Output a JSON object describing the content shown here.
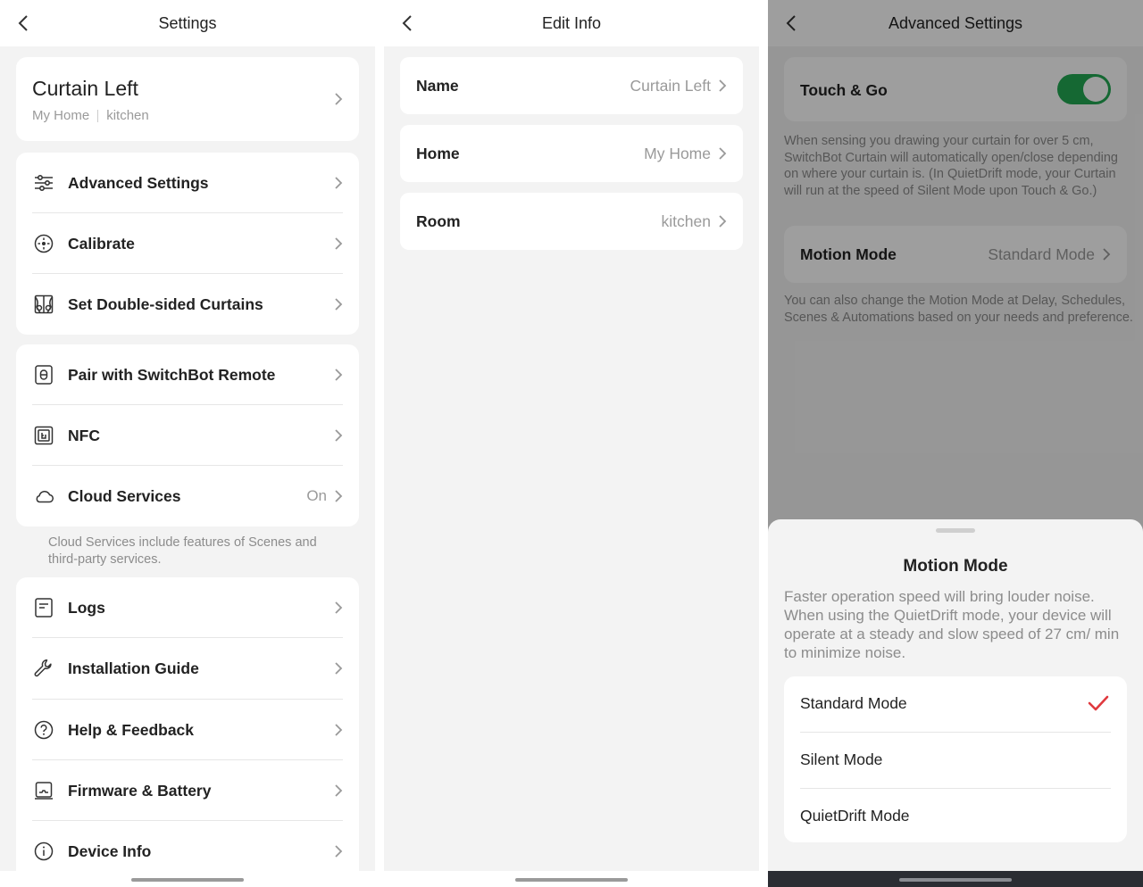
{
  "settings": {
    "title": "Settings",
    "device_name": "Curtain Left",
    "home": "My Home",
    "room": "kitchen",
    "group1": [
      {
        "label": "Advanced Settings",
        "icon": "sliders-icon"
      },
      {
        "label": "Calibrate",
        "icon": "calibrate-icon"
      },
      {
        "label": "Set Double-sided Curtains",
        "icon": "double-curtain-icon"
      }
    ],
    "group2": [
      {
        "label": "Pair with SwitchBot Remote",
        "icon": "remote-icon",
        "value": ""
      },
      {
        "label": "NFC",
        "icon": "nfc-icon",
        "value": ""
      },
      {
        "label": "Cloud Services",
        "icon": "cloud-icon",
        "value": "On"
      }
    ],
    "cloud_note": "Cloud Services include features of Scenes and third-party services.",
    "group3": [
      {
        "label": "Logs",
        "icon": "logs-icon"
      },
      {
        "label": "Installation Guide",
        "icon": "wrench-icon"
      },
      {
        "label": "Help & Feedback",
        "icon": "help-icon"
      },
      {
        "label": "Firmware & Battery",
        "icon": "firmware-icon"
      },
      {
        "label": "Device Info",
        "icon": "info-icon"
      }
    ]
  },
  "edit_info": {
    "title": "Edit Info",
    "rows": [
      {
        "label": "Name",
        "value": "Curtain Left"
      },
      {
        "label": "Home",
        "value": "My Home"
      },
      {
        "label": "Room",
        "value": "kitchen"
      }
    ]
  },
  "advanced": {
    "title": "Advanced Settings",
    "touch_go_label": "Touch & Go",
    "touch_go_on": true,
    "touch_go_note": "When sensing you drawing your curtain for over 5 cm, SwitchBot Curtain will automatically open/close depending on where your curtain is. (In QuietDrift mode, your Curtain will run at the speed of Silent Mode upon Touch & Go.)",
    "motion_label": "Motion Mode",
    "motion_value": "Standard Mode",
    "motion_note": "You can also change the Motion Mode at Delay, Schedules, Scenes & Automations based on your needs and preference.",
    "sheet": {
      "title": "Motion Mode",
      "description": "Faster operation speed will bring louder noise. When using the QuietDrift mode, your device will operate at a steady and slow speed of 27 cm/ min to minimize noise.",
      "options": [
        "Standard Mode",
        "Silent Mode",
        "QuietDrift Mode"
      ],
      "selected": "Standard Mode"
    }
  },
  "colors": {
    "toggle_on": "#23a853",
    "check": "#e0393e"
  }
}
